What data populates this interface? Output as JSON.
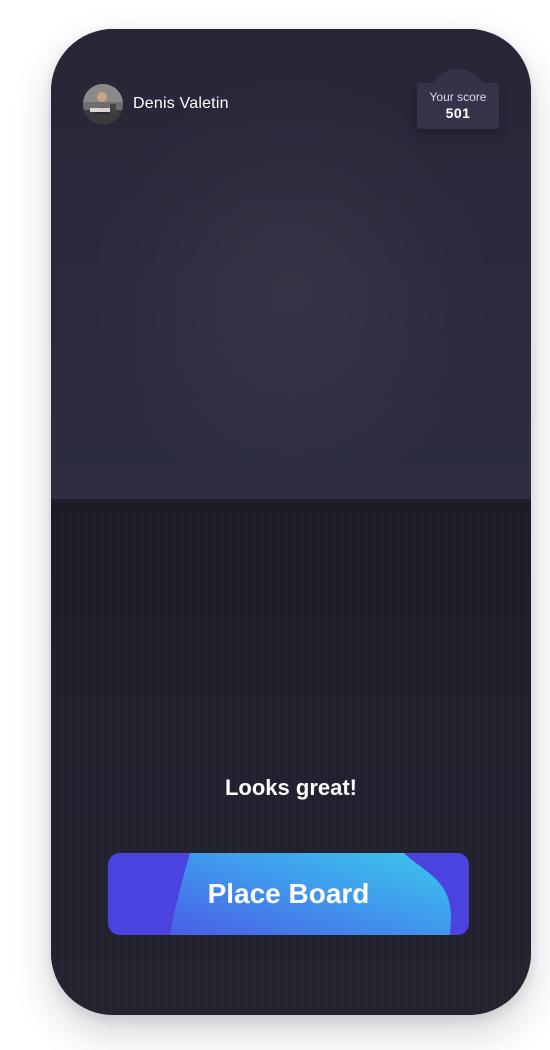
{
  "user": {
    "name": "Denis Valetin",
    "avatar_icon": "user-photo-avatar"
  },
  "score": {
    "label": "Your score",
    "value": "501"
  },
  "status": {
    "message": "Looks great!"
  },
  "actions": {
    "place_board_label": "Place Board"
  },
  "colors": {
    "background": "#23222f",
    "badge": "#34334a",
    "button_start": "#4b43e0",
    "button_end": "#3eb9ec"
  }
}
